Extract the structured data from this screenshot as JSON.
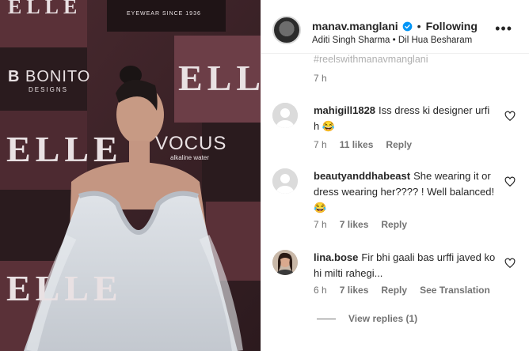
{
  "media": {
    "logos": {
      "elle": "ELLE",
      "bonito": "BONITO",
      "bonito_sub": "DESIGNS",
      "vocus": "VOCUS",
      "vocus_sub": "alkaline water",
      "eyewear": "EYEWEAR SINCE 1936"
    }
  },
  "header": {
    "username": "manav.manglani",
    "follow_status": "Following",
    "subline": "Aditi Singh Sharma • Dil Hua Besharam",
    "more_label": "•••"
  },
  "cutoff": {
    "text": "#reelswithmanavmanglani",
    "time": "7 h"
  },
  "comments": [
    {
      "username": "mahigill1828",
      "text": "Iss dress ki designer urfi h 😂",
      "time": "7 h",
      "likes": "11 likes",
      "reply": "Reply"
    },
    {
      "username": "beautyanddhabeast",
      "text": "She wearing it or dress wearing her???? ! Well balanced! 😂",
      "time": "7 h",
      "likes": "7 likes",
      "reply": "Reply"
    },
    {
      "username": "lina.bose",
      "text": "Fir bhi gaali bas urffi javed ko hi milti rahegi...",
      "time": "6 h",
      "likes": "7 likes",
      "reply": "Reply",
      "translation": "See Translation"
    }
  ],
  "view_replies": "View replies (1)",
  "colors": {
    "verified": "#0095f6",
    "muted": "#737373",
    "text": "#262626"
  }
}
